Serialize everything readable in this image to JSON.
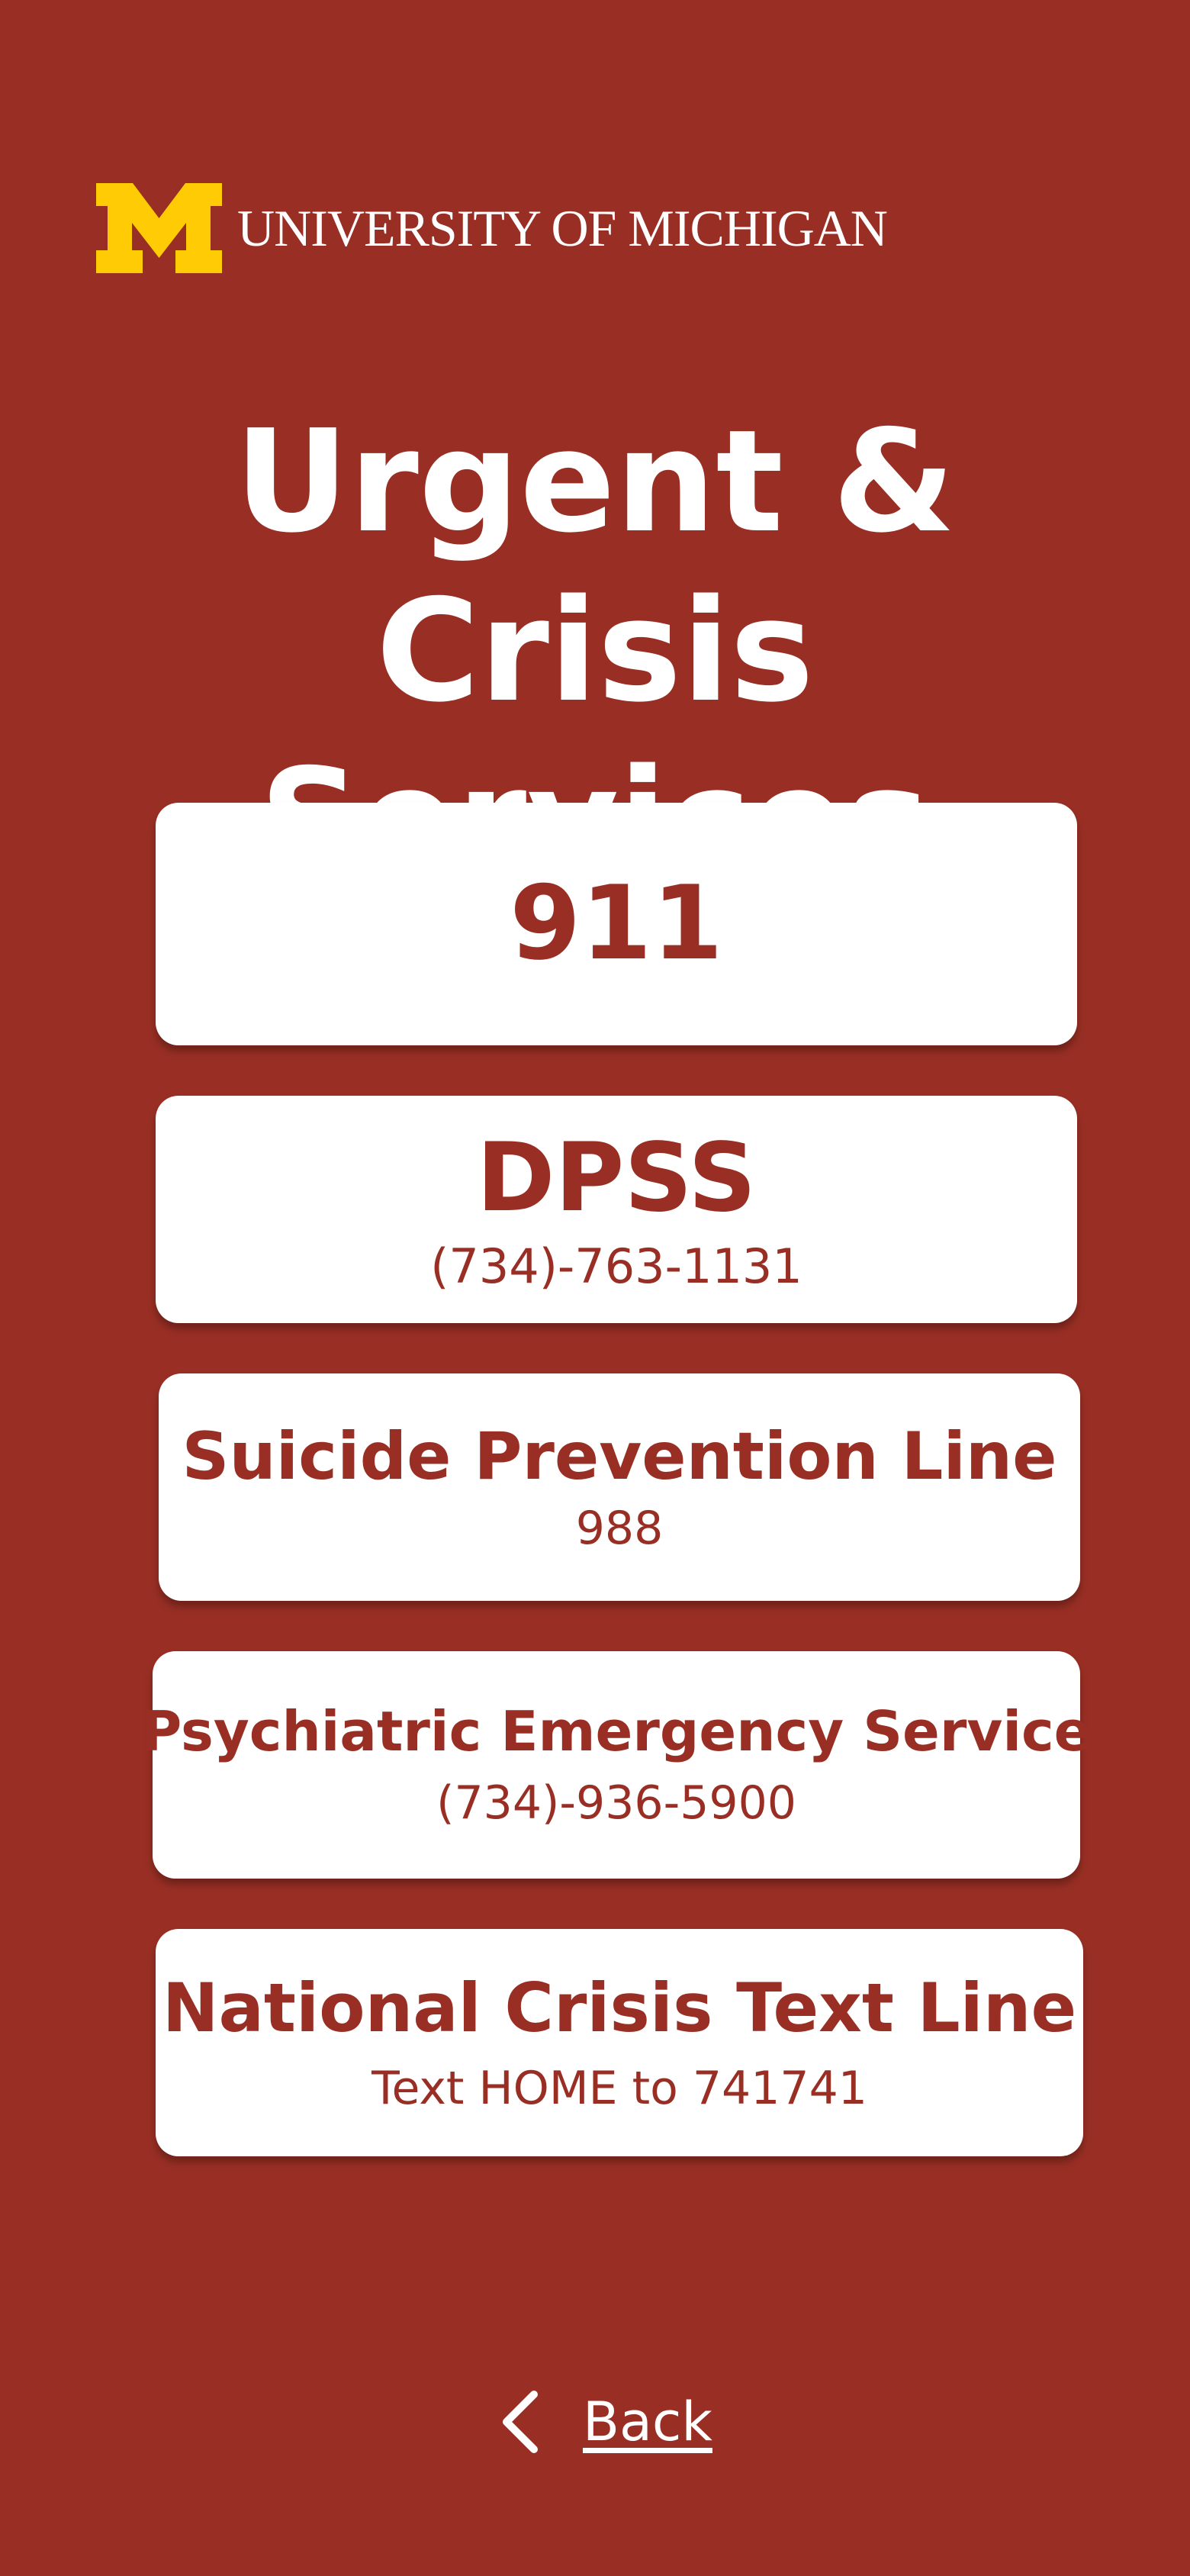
{
  "header": {
    "logo_mark": "M",
    "wordmark": "UNIVERSITY OF MICHIGAN",
    "brand_maize": "#FFCB05"
  },
  "page": {
    "title_line1": "Urgent & Crisis",
    "title_line2": "Services"
  },
  "services": [
    {
      "name": "911"
    },
    {
      "name": "DPSS",
      "detail": "(734)-763-1131"
    },
    {
      "name": "Suicide Prevention Line",
      "detail": "988"
    },
    {
      "name": "Psychiatric Emergency Service",
      "detail": "(734)-936-5900"
    },
    {
      "name": "National Crisis Text Line",
      "detail": "Text HOME to 741741"
    }
  ],
  "footer": {
    "back_label": "Back",
    "back_icon": "chevron-left-icon"
  },
  "colors": {
    "background": "#992F24",
    "card": "#FFFFFF",
    "card_text": "#992F24",
    "text_light": "#FFFFFF"
  }
}
